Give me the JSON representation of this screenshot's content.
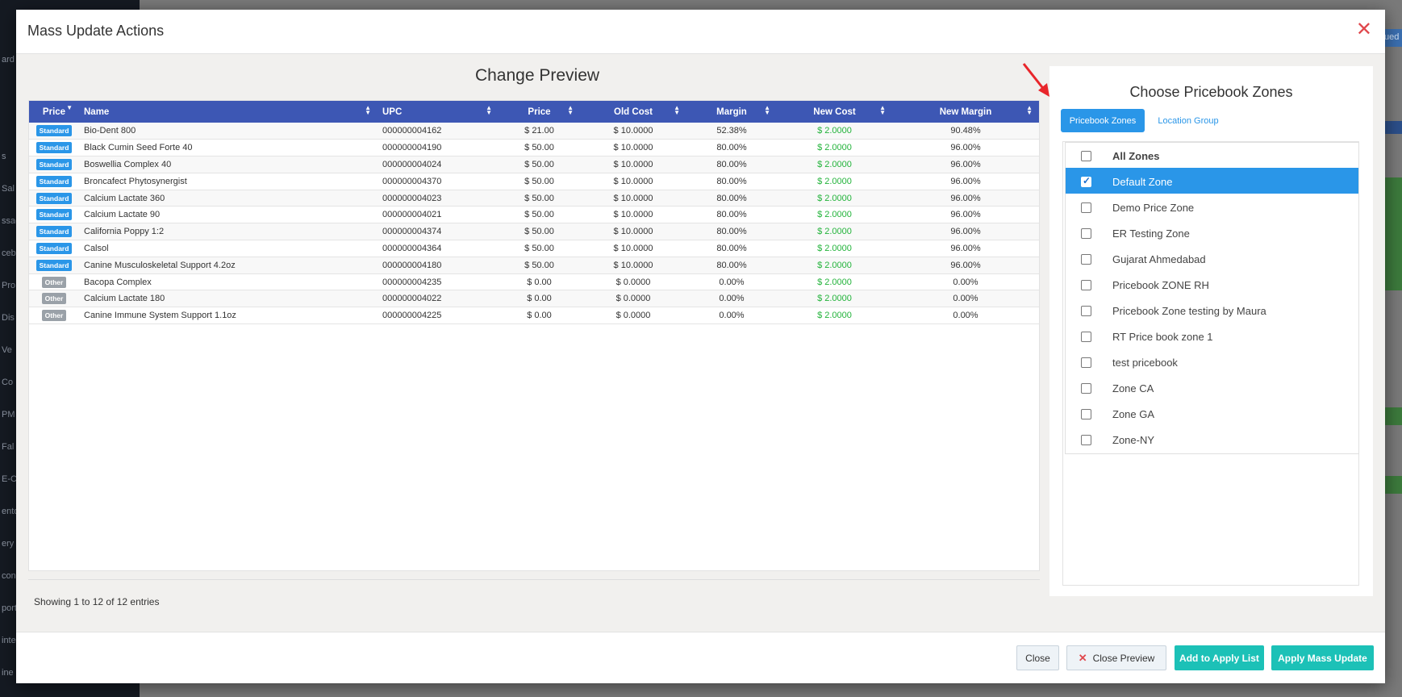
{
  "background": {
    "nav_fragments": [
      "ard",
      "s",
      "Sal",
      "ssag",
      "cebo",
      "Pro",
      "Dis",
      "Ve",
      "Co",
      "PM",
      "Fal",
      "E-C",
      "ento",
      "ery",
      "con",
      "ports",
      "inte",
      "ine"
    ],
    "right_fragment": "ued"
  },
  "modal": {
    "title": "Mass Update Actions",
    "close_icon": "close-icon"
  },
  "preview": {
    "title": "Change Preview",
    "columns": [
      "Price",
      "Name",
      "UPC",
      "Price",
      "Old Cost",
      "Margin",
      "New Cost",
      "New Margin"
    ],
    "rows": [
      {
        "type": "Standard",
        "name": "Bio-Dent 800",
        "upc": "000000004162",
        "price": "$ 21.00",
        "old_cost": "$ 10.0000",
        "margin": "52.38%",
        "new_cost": "$ 2.0000",
        "new_margin": "90.48%"
      },
      {
        "type": "Standard",
        "name": "Black Cumin Seed Forte 40",
        "upc": "000000004190",
        "price": "$ 50.00",
        "old_cost": "$ 10.0000",
        "margin": "80.00%",
        "new_cost": "$ 2.0000",
        "new_margin": "96.00%"
      },
      {
        "type": "Standard",
        "name": "Boswellia Complex 40",
        "upc": "000000004024",
        "price": "$ 50.00",
        "old_cost": "$ 10.0000",
        "margin": "80.00%",
        "new_cost": "$ 2.0000",
        "new_margin": "96.00%"
      },
      {
        "type": "Standard",
        "name": "Broncafect Phytosynergist",
        "upc": "000000004370",
        "price": "$ 50.00",
        "old_cost": "$ 10.0000",
        "margin": "80.00%",
        "new_cost": "$ 2.0000",
        "new_margin": "96.00%"
      },
      {
        "type": "Standard",
        "name": "Calcium Lactate 360",
        "upc": "000000004023",
        "price": "$ 50.00",
        "old_cost": "$ 10.0000",
        "margin": "80.00%",
        "new_cost": "$ 2.0000",
        "new_margin": "96.00%"
      },
      {
        "type": "Standard",
        "name": "Calcium Lactate 90",
        "upc": "000000004021",
        "price": "$ 50.00",
        "old_cost": "$ 10.0000",
        "margin": "80.00%",
        "new_cost": "$ 2.0000",
        "new_margin": "96.00%"
      },
      {
        "type": "Standard",
        "name": "California Poppy 1:2",
        "upc": "000000004374",
        "price": "$ 50.00",
        "old_cost": "$ 10.0000",
        "margin": "80.00%",
        "new_cost": "$ 2.0000",
        "new_margin": "96.00%"
      },
      {
        "type": "Standard",
        "name": "Calsol",
        "upc": "000000004364",
        "price": "$ 50.00",
        "old_cost": "$ 10.0000",
        "margin": "80.00%",
        "new_cost": "$ 2.0000",
        "new_margin": "96.00%"
      },
      {
        "type": "Standard",
        "name": "Canine Musculoskeletal Support 4.2oz",
        "upc": "000000004180",
        "price": "$ 50.00",
        "old_cost": "$ 10.0000",
        "margin": "80.00%",
        "new_cost": "$ 2.0000",
        "new_margin": "96.00%"
      },
      {
        "type": "Other",
        "name": "Bacopa Complex",
        "upc": "000000004235",
        "price": "$ 0.00",
        "old_cost": "$ 0.0000",
        "margin": "0.00%",
        "new_cost": "$ 2.0000",
        "new_margin": "0.00%"
      },
      {
        "type": "Other",
        "name": "Calcium Lactate 180",
        "upc": "000000004022",
        "price": "$ 0.00",
        "old_cost": "$ 0.0000",
        "margin": "0.00%",
        "new_cost": "$ 2.0000",
        "new_margin": "0.00%"
      },
      {
        "type": "Other",
        "name": "Canine Immune System Support 1.1oz",
        "upc": "000000004225",
        "price": "$ 0.00",
        "old_cost": "$ 0.0000",
        "margin": "0.00%",
        "new_cost": "$ 2.0000",
        "new_margin": "0.00%"
      }
    ],
    "showing": "Showing 1 to 12 of 12 entries"
  },
  "zones": {
    "title": "Choose Pricebook Zones",
    "tab_active": "Pricebook Zones",
    "tab_inactive": "Location Group",
    "items": [
      {
        "label": "All Zones",
        "checked": false
      },
      {
        "label": "Default Zone",
        "checked": true
      },
      {
        "label": "Demo Price Zone",
        "checked": false
      },
      {
        "label": "ER Testing Zone",
        "checked": false
      },
      {
        "label": "Gujarat Ahmedabad",
        "checked": false
      },
      {
        "label": "Pricebook ZONE RH",
        "checked": false
      },
      {
        "label": "Pricebook Zone testing by Maura",
        "checked": false
      },
      {
        "label": "RT Price book zone 1",
        "checked": false
      },
      {
        "label": "test pricebook",
        "checked": false
      },
      {
        "label": "Zone CA",
        "checked": false
      },
      {
        "label": "Zone GA",
        "checked": false
      },
      {
        "label": "Zone-NY",
        "checked": false
      }
    ]
  },
  "footer": {
    "close": "Close",
    "close_preview": "Close Preview",
    "add_to_apply_list": "Add to Apply List",
    "apply_mass_update": "Apply Mass Update"
  },
  "colors": {
    "header_blue": "#3d57b4",
    "accent_blue": "#2a96e8",
    "teal": "#1cc1b7",
    "green_text": "#22b33a",
    "danger": "#e0474c"
  }
}
